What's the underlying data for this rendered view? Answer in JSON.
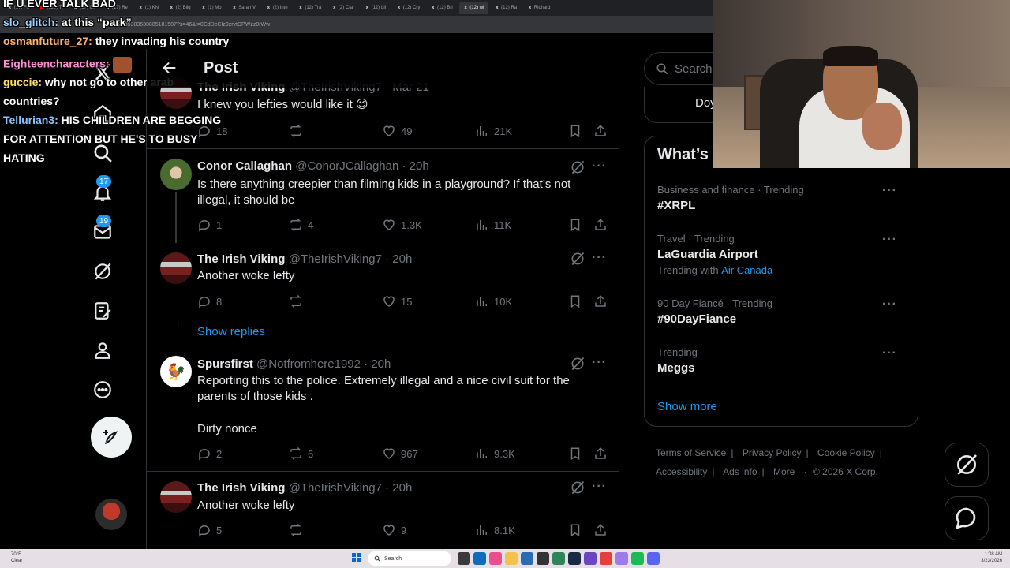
{
  "browser": {
    "tabs": [
      "(17) Fo",
      "(115) Tl",
      "(17) Or",
      "(17) Re",
      "(1) KN",
      "(2) Bilg",
      "(1) Mo",
      "Sarah V",
      "(2) Inte",
      "(12) Tra",
      "(2) Clar",
      "(12) Lil",
      "(12) Cry",
      "(12) Bri",
      "(12) wi",
      "(12) Ra",
      "Richard"
    ],
    "url": "2035383530885181587?s=46&t=0CdDcCIz9zrvtDPWzz0rWw"
  },
  "header": {
    "title": "Post"
  },
  "nav": {
    "notifications_badge": "17",
    "messages_badge": "19"
  },
  "tweets": [
    {
      "name": "The Irish Viking",
      "handle": "@TheIrishViking7",
      "time": "· Mar 21",
      "text": "I knew you lefties would like it 😉",
      "replies": "18",
      "retweets": "",
      "likes": "49",
      "views": "21K"
    },
    {
      "name": "Conor Callaghan",
      "handle": "@ConorJCallaghan",
      "time": "· 20h",
      "text": "Is there anything creepier than filming kids in a playground? If that’s not illegal, it should be",
      "replies": "1",
      "retweets": "4",
      "likes": "1.3K",
      "views": "11K"
    },
    {
      "name": "The Irish Viking",
      "handle": "@TheIrishViking7",
      "time": "· 20h",
      "text": "Another woke lefty",
      "replies": "8",
      "retweets": "",
      "likes": "15",
      "views": "10K"
    },
    {
      "name": "Spursfirst",
      "handle": "@Notfromhere1992",
      "time": "· 20h",
      "text": "Reporting this to the police. Extremely illegal and a nice civil suit for the parents of those kids .",
      "text2": "Dirty nonce",
      "replies": "2",
      "retweets": "6",
      "likes": "967",
      "views": "9.3K"
    },
    {
      "name": "The Irish Viking",
      "handle": "@TheIrishViking7",
      "time": "· 20h",
      "text": "Another woke lefty",
      "replies": "5",
      "retweets": "",
      "likes": "9",
      "views": "8.1K"
    }
  ],
  "show_replies": "Show replies",
  "right": {
    "search_placeholder": "Search",
    "prev_card_text": "Doy",
    "trends_title": "What’s",
    "trends": [
      {
        "meta": "Business and finance · Trending",
        "name": "#XRPL",
        "with_label": "",
        "with_link": ""
      },
      {
        "meta": "Travel · Trending",
        "name": "LaGuardia Airport",
        "with_label": "Trending with",
        "with_link": "Air Canada"
      },
      {
        "meta": "90 Day Fiancé · Trending",
        "name": "#90DayFiance",
        "with_label": "",
        "with_link": ""
      },
      {
        "meta": "Trending",
        "name": "Meggs",
        "with_label": "",
        "with_link": ""
      }
    ],
    "show_more": "Show more",
    "footer": {
      "terms": "Terms of Service",
      "privacy": "Privacy Policy",
      "cookie": "Cookie Policy",
      "accessibility": "Accessibility",
      "ads": "Ads info",
      "more": "More ···",
      "copyright": "© 2026 X Corp."
    }
  },
  "chat": [
    {
      "user": "",
      "message": "IF U EVER TALK BAD"
    },
    {
      "user": "slo_glitch:",
      "message": "at this “park”"
    },
    {
      "user": "osmanfuture_27:",
      "message": "they invading his country"
    },
    {
      "user": "Eighteencharacters:",
      "message": ""
    },
    {
      "user": "guccie:",
      "message": "why not go to other arab"
    },
    {
      "user": "",
      "message": "countries?"
    },
    {
      "user": "Tellurian3:",
      "message": "HIS CHILDREN ARE BEGGING"
    },
    {
      "user": "",
      "message": "FOR ATTENTION BUT HE'S TO BUSY"
    },
    {
      "user": "",
      "message": "HATING"
    }
  ],
  "taskbar": {
    "weather_temp": "70°F",
    "weather_desc": "Clear",
    "search": "Search",
    "time": "1:08 AM",
    "date": "3/23/2026"
  },
  "colors": {
    "accent": "#1d9bf0",
    "background": "#000000",
    "border": "#2f3336",
    "secondary_text": "#71767b"
  }
}
